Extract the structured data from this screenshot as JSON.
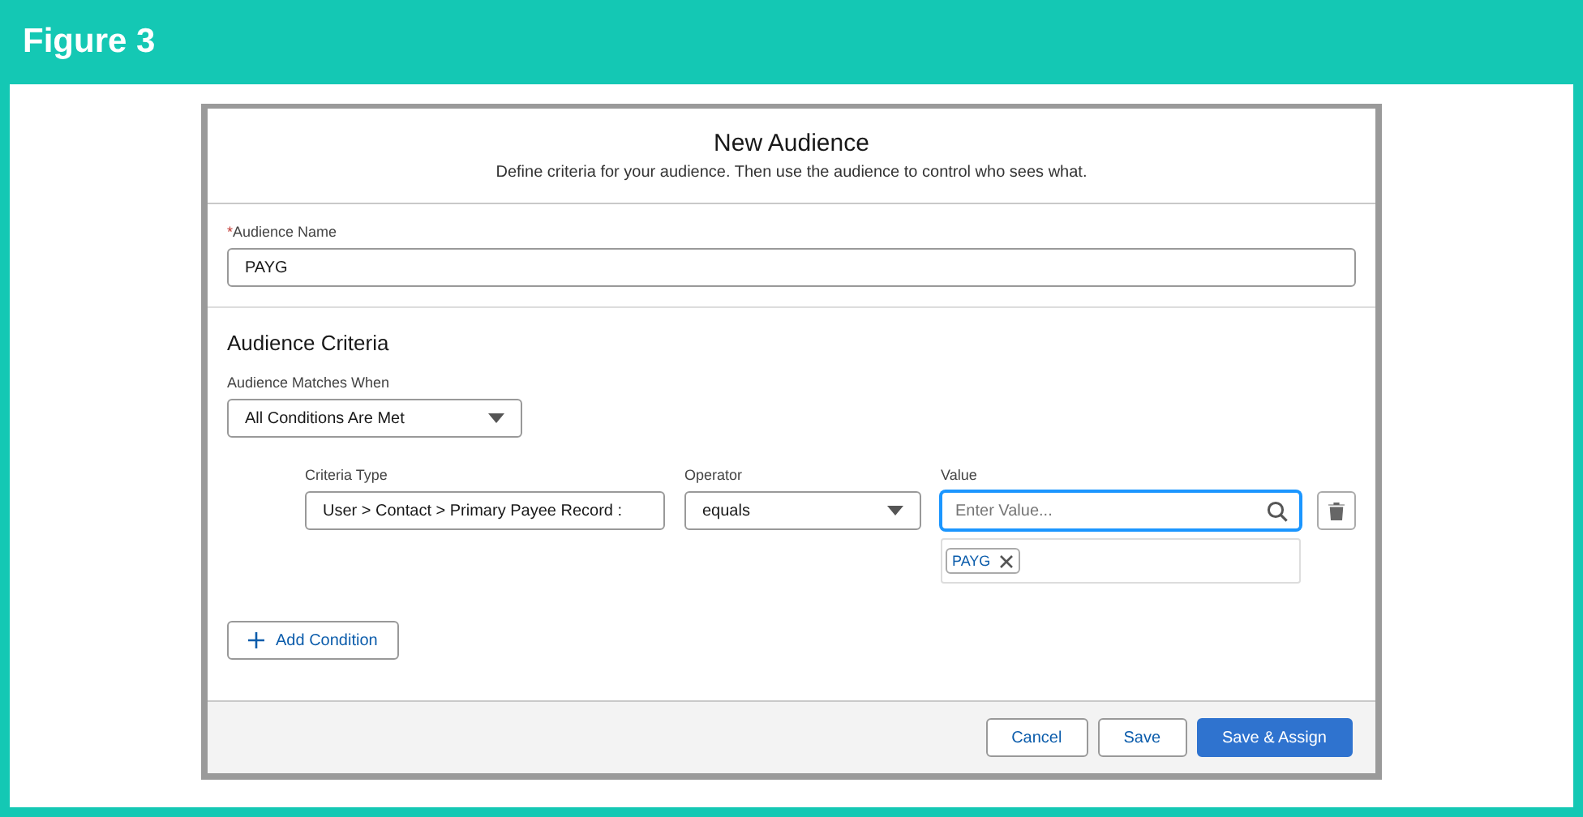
{
  "figure": {
    "title": "Figure 3"
  },
  "modal": {
    "title": "New Audience",
    "subtitle": "Define criteria for your audience. Then use the audience to control who sees what."
  },
  "name_field": {
    "label": "Audience Name",
    "required_mark": "*",
    "value": "PAYG"
  },
  "criteria": {
    "heading": "Audience Criteria",
    "match_label": "Audience Matches When",
    "match_value": "All Conditions Are Met",
    "condition": {
      "type_label": "Criteria Type",
      "type_value": "User > Contact > Primary Payee Record :",
      "operator_label": "Operator",
      "operator_value": "equals",
      "value_label": "Value",
      "value_placeholder": "Enter Value...",
      "pills": [
        "PAYG"
      ]
    },
    "add_button": "Add Condition"
  },
  "buttons": [
    {
      "label": "Cancel",
      "kind": "neutral"
    },
    {
      "label": "Save",
      "kind": "neutral"
    },
    {
      "label": "Save & Assign",
      "kind": "brand"
    }
  ]
}
